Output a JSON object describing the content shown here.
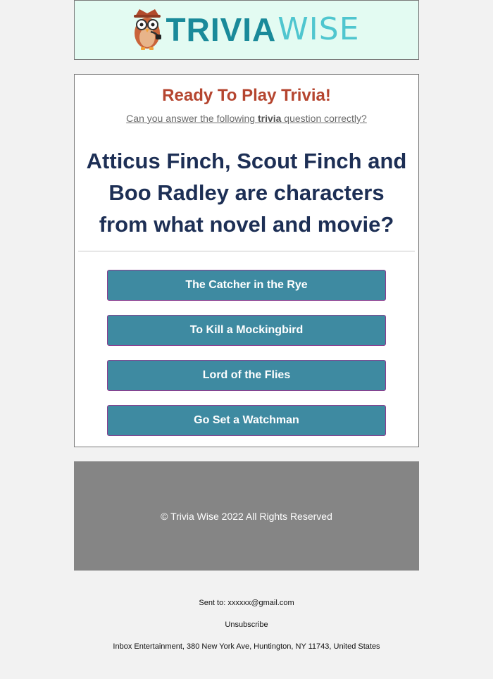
{
  "header": {
    "logo_trivia": "TRIVIA",
    "logo_wise": "WISE",
    "logo_mascot": "owl-mascot-icon"
  },
  "card": {
    "title": "Ready To Play Trivia!",
    "subtitle_before": "Can you answer the following ",
    "subtitle_bold": "trivia",
    "subtitle_after": " question correctly?",
    "question": "Atticus Finch, Scout Finch and Boo Radley are characters from what novel and movie?",
    "answers": [
      {
        "label": "The Catcher in the Rye"
      },
      {
        "label": "To Kill a Mockingbird"
      },
      {
        "label": "Lord of the Flies"
      },
      {
        "label": "Go Set a Watchman"
      }
    ]
  },
  "footer": {
    "copyright": "© Trivia Wise 2022 All Rights Reserved"
  },
  "meta": {
    "sent_to": "Sent to: xxxxxx@gmail.com",
    "unsubscribe": "Unsubscribe",
    "address": "Inbox Entertainment, 380 New York Ave, Huntington, NY 11743, United States"
  },
  "colors": {
    "accent": "#3e8aa1",
    "title_red": "#b5452f",
    "question_navy": "#1d2f55",
    "footer_gray": "#858585"
  }
}
